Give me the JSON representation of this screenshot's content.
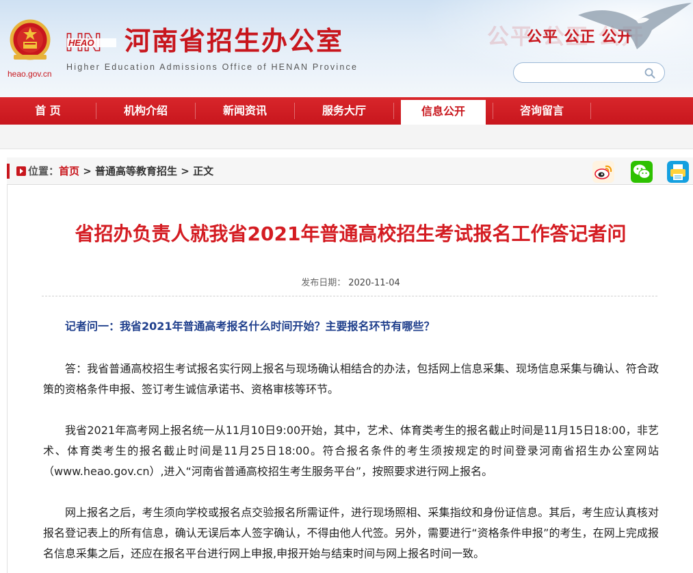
{
  "header": {
    "emblem_caption": "heao.gov.cn",
    "logo_text": "HEAO",
    "logo_mark": "HN",
    "title": "河南省招生办公室",
    "subtitle": "Higher Education Admissions Office of HENAN Province",
    "slogan": "公平 公正 公开",
    "search": {
      "placeholder": "",
      "value": ""
    },
    "icons": [
      "national-emblem-icon",
      "eagle-icon",
      "search-icon"
    ]
  },
  "nav": {
    "items": [
      {
        "label": "首 页"
      },
      {
        "label": "机构介绍"
      },
      {
        "label": "新闻资讯"
      },
      {
        "label": "服务大厅"
      },
      {
        "label": "信息公开",
        "active": true
      },
      {
        "label": "咨询留言"
      }
    ]
  },
  "breadcrumb": {
    "prefix": "位置：",
    "home": "首页",
    "sep": " > ",
    "section": "普通高等教育招生",
    "current": "正文",
    "share_icons": [
      "weibo-icon",
      "wechat-icon",
      "print-icon"
    ]
  },
  "article": {
    "title": "省招办负责人就我省2021年普通高校招生考试报名工作答记者问",
    "date_label": "发布日期：",
    "date": "2020-11-04",
    "question": "记者问一：我省2021年普通高考报名什么时间开始？主要报名环节有哪些？",
    "paragraphs": [
      "答：我省普通高校招生考试报名实行网上报名与现场确认相结合的办法，包括网上信息采集、现场信息采集与确认、符合政策的资格条件申报、签订考生诚信承诺书、资格审核等环节。",
      "我省2021年高考网上报名统一从11月10日9:00开始，其中，艺术、体育类考生的报名截止时间是11月15日18:00，非艺术、体育类考生的报名截止时间是11月25日18:00。符合报名条件的考生须按规定的时间登录河南省招生办公室网站（www.heao.gov.cn）,进入“河南省普通高校招生考生服务平台”，按照要求进行网上报名。",
      "网上报名之后，考生须向学校或报名点交验报名所需证件，进行现场照相、采集指纹和身份证信息。其后，考生应认真核对报名登记表上的所有信息，确认无误后本人签字确认，不得由他人代签。另外，需要进行“资格条件申报”的考生，在网上完成报名信息采集之后，还应在报名平台进行网上申报,申报开始与结束时间与网上报名时间一致。"
    ]
  },
  "colors": {
    "brand_red": "#c8161d",
    "question_blue": "#1f3f8c",
    "header_sky": "#cfe1f3"
  }
}
